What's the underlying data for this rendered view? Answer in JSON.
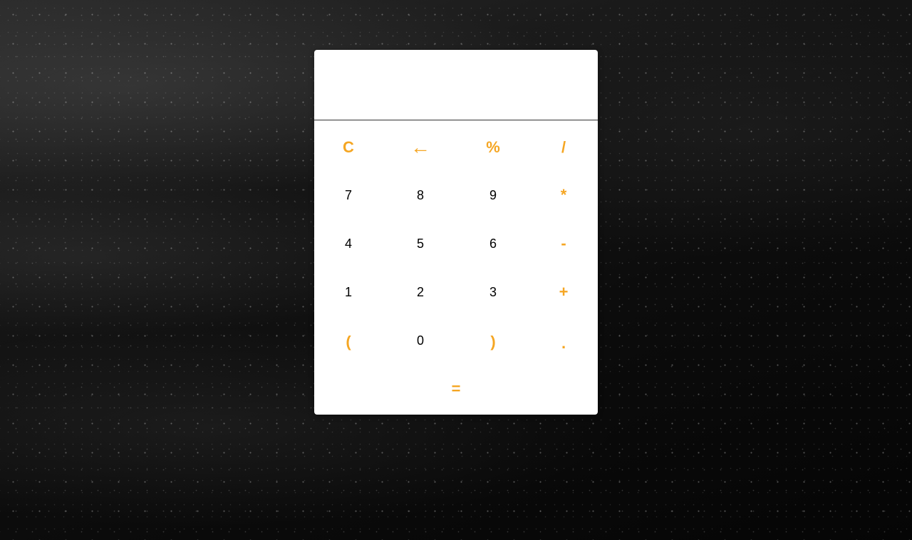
{
  "calculator": {
    "display_value": "",
    "accent_color": "#f5a623",
    "keys": {
      "clear": "C",
      "backspace": "←",
      "percent": "%",
      "divide": "/",
      "seven": "7",
      "eight": "8",
      "nine": "9",
      "multiply": "*",
      "four": "4",
      "five": "5",
      "six": "6",
      "subtract": "-",
      "one": "1",
      "two": "2",
      "three": "3",
      "add": "+",
      "open_paren": "(",
      "zero": "0",
      "close_paren": ")",
      "decimal": ".",
      "equals": "="
    }
  }
}
